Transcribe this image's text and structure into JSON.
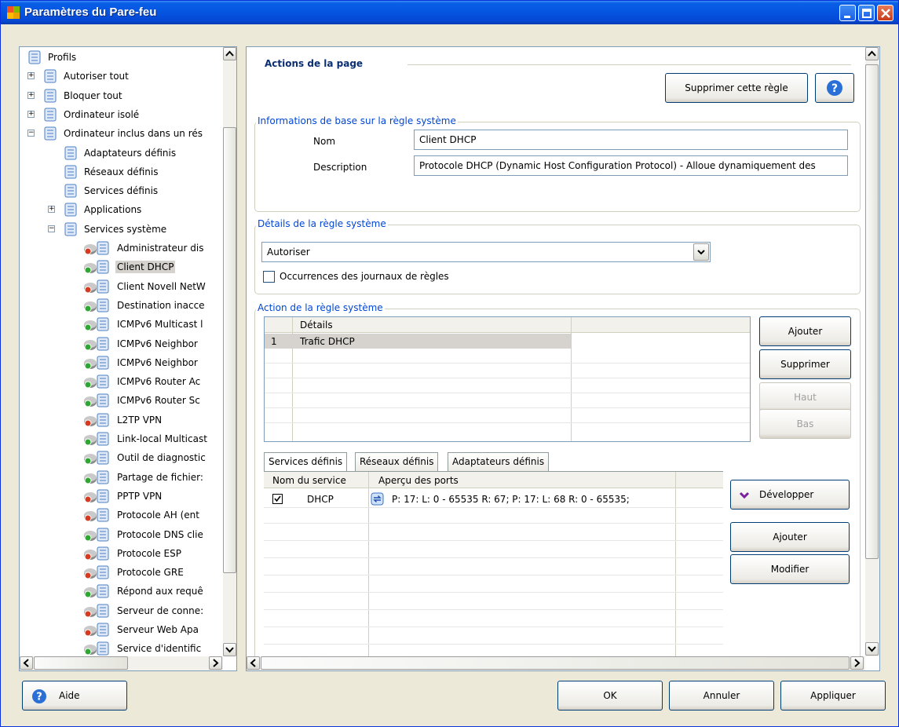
{
  "window": {
    "title": "Paramètres du Pare-feu"
  },
  "tree": {
    "items": [
      {
        "label": "Profils",
        "level": 0,
        "icon": "profile-icon"
      },
      {
        "label": "Autoriser tout",
        "level": 1,
        "icon": "profile-icon",
        "expander": "+"
      },
      {
        "label": "Bloquer tout",
        "level": 1,
        "icon": "profile-icon",
        "expander": "+"
      },
      {
        "label": "Ordinateur isolé",
        "level": 1,
        "icon": "profile-icon",
        "expander": "+"
      },
      {
        "label": "Ordinateur inclus dans un rés",
        "level": 1,
        "icon": "profile-icon",
        "expander": "-"
      },
      {
        "label": "Adaptateurs définis",
        "level": 2,
        "icon": "profile-icon"
      },
      {
        "label": "Réseaux définis",
        "level": 2,
        "icon": "profile-icon"
      },
      {
        "label": "Services définis",
        "level": 2,
        "icon": "profile-icon"
      },
      {
        "label": "Applications",
        "level": 2,
        "icon": "profile-icon",
        "expander": "+"
      },
      {
        "label": "Services système",
        "level": 2,
        "icon": "profile-icon",
        "expander": "-"
      },
      {
        "label": "Administrateur dis",
        "level": 3,
        "icon": "service-block-icon"
      },
      {
        "label": "Client DHCP",
        "level": 3,
        "icon": "service-allow-icon",
        "selected": true
      },
      {
        "label": "Client Novell NetW",
        "level": 3,
        "icon": "service-block-icon"
      },
      {
        "label": "Destination inacce",
        "level": 3,
        "icon": "service-allow-icon"
      },
      {
        "label": "ICMPv6 Multicast l",
        "level": 3,
        "icon": "service-allow-icon"
      },
      {
        "label": "ICMPv6 Neighbor",
        "level": 3,
        "icon": "service-allow-icon"
      },
      {
        "label": "ICMPv6 Neighbor",
        "level": 3,
        "icon": "service-allow-icon"
      },
      {
        "label": "ICMPv6 Router Ac",
        "level": 3,
        "icon": "service-allow-icon"
      },
      {
        "label": "ICMPv6 Router Sc",
        "level": 3,
        "icon": "service-allow-icon"
      },
      {
        "label": "L2TP VPN",
        "level": 3,
        "icon": "service-block-icon"
      },
      {
        "label": "Link-local Multicast",
        "level": 3,
        "icon": "service-allow-icon"
      },
      {
        "label": "Outil de diagnostic",
        "level": 3,
        "icon": "service-allow-icon"
      },
      {
        "label": "Partage de fichier:",
        "level": 3,
        "icon": "service-allow-icon"
      },
      {
        "label": "PPTP VPN",
        "level": 3,
        "icon": "service-block-icon"
      },
      {
        "label": "Protocole AH (ent",
        "level": 3,
        "icon": "service-block-icon"
      },
      {
        "label": "Protocole DNS clie",
        "level": 3,
        "icon": "service-allow-icon"
      },
      {
        "label": "Protocole ESP",
        "level": 3,
        "icon": "service-block-icon"
      },
      {
        "label": "Protocole GRE",
        "level": 3,
        "icon": "service-block-icon"
      },
      {
        "label": "Répond aux requê",
        "level": 3,
        "icon": "service-allow-icon"
      },
      {
        "label": "Serveur de conne:",
        "level": 3,
        "icon": "service-block-icon"
      },
      {
        "label": "Serveur Web Apa",
        "level": 3,
        "icon": "service-block-icon"
      },
      {
        "label": "Service d'identific",
        "level": 3,
        "icon": "service-allow-icon"
      }
    ]
  },
  "page": {
    "actions_title": "Actions de la page",
    "delete_rule_button": "Supprimer cette règle",
    "basic_info": {
      "title": "Informations de base sur la règle système",
      "name_label": "Nom",
      "name_value": "Client DHCP",
      "description_label": "Description",
      "description_value": "Protocole DHCP (Dynamic Host Configuration Protocol) - Alloue dynamiquement des"
    },
    "details": {
      "title": "Détails de la règle système",
      "action_select": "Autoriser",
      "log_checkbox_label": "Occurrences des journaux de règles",
      "log_checked": false
    },
    "action": {
      "title": "Action de la règle système",
      "header_details": "Détails",
      "rows": [
        {
          "num": "1",
          "details": "Trafic DHCP"
        }
      ],
      "buttons": {
        "add": "Ajouter",
        "delete": "Supprimer",
        "up": "Haut",
        "down": "Bas"
      }
    },
    "tabs": [
      "Services définis",
      "Réseaux définis",
      "Adaptateurs définis"
    ],
    "services": {
      "col_name": "Nom du service",
      "col_ports": "Aperçu des ports",
      "rows": [
        {
          "checked": true,
          "name": "DHCP",
          "ports": "P: 17:  L: 0 - 65535 R: 67; P: 17:  L: 68 R: 0 - 65535;"
        }
      ],
      "buttons": {
        "expand": "Développer",
        "add": "Ajouter",
        "modify": "Modifier"
      }
    }
  },
  "footer": {
    "help": "Aide",
    "ok": "OK",
    "cancel": "Annuler",
    "apply": "Appliquer"
  }
}
